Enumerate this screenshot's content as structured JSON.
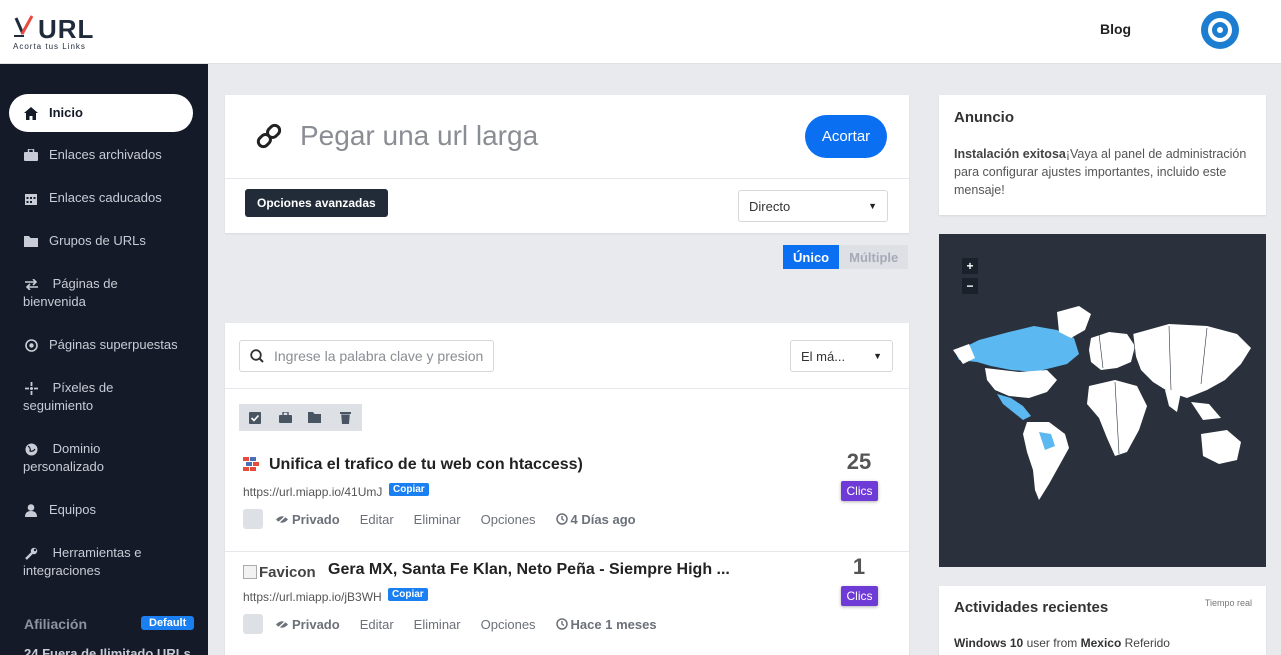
{
  "header": {
    "logo_word": "URL",
    "logo_tagline": "Acorta tus Links",
    "blog_label": "Blog"
  },
  "sidebar": {
    "items": [
      {
        "label": "Inicio",
        "icon": "home-icon"
      },
      {
        "label": "Enlaces archivados",
        "icon": "briefcase-icon"
      },
      {
        "label": "Enlaces caducados",
        "icon": "calendar-icon"
      },
      {
        "label": "Grupos de URLs",
        "icon": "folder-icon"
      },
      {
        "label": "Páginas de bienvenida",
        "icon": "arrows-icon"
      },
      {
        "label": "Páginas superpuestas",
        "icon": "target-icon"
      },
      {
        "label": "Píxeles de seguimiento",
        "icon": "crosshair-icon"
      },
      {
        "label": "Dominio personalizado",
        "icon": "globe-icon"
      },
      {
        "label": "Equipos",
        "icon": "user-icon"
      },
      {
        "label": "Herramientas e integraciones",
        "icon": "wrench-icon"
      }
    ],
    "affiliate_label": "Afiliación",
    "affiliate_badge": "Default",
    "usage_text": "24 Fuera de Ilimitado URLs"
  },
  "shorten": {
    "placeholder": "Pegar una url larga",
    "submit_label": "Acortar",
    "advanced_label": "Opciones avanzadas",
    "redirect_selected": "Directo",
    "mode_single": "Único",
    "mode_multiple": "Múltiple"
  },
  "links": {
    "search_placeholder": "Ingrese la palabra clave y presione Enter",
    "sort_selected": "El má...",
    "rows": [
      {
        "title": "Unifica el trafico de tu web con htaccess)",
        "short_url": "https://url.miapp.io/41UmJ",
        "copy_label": "Copiar",
        "privacy": "Privado",
        "edit": "Editar",
        "delete": "Eliminar",
        "options": "Opciones",
        "age": "4 Días ago",
        "clicks": "25",
        "clicks_label": "Clics"
      },
      {
        "favicon_alt": "Favicon",
        "title": "Gera MX, Santa Fe Klan, Neto Peña - Siempre High ...",
        "short_url": "https://url.miapp.io/jB3WH",
        "copy_label": "Copiar",
        "privacy": "Privado",
        "edit": "Editar",
        "delete": "Eliminar",
        "options": "Opciones",
        "age": "Hace 1 meses",
        "clicks": "1",
        "clicks_label": "Clics"
      }
    ]
  },
  "announcement": {
    "title": "Anuncio",
    "bold": "Instalación exitosa",
    "text": "¡Vaya al panel de administración para configurar ajustes importantes, incluido este mensaje!"
  },
  "map": {
    "zoom_in": "+",
    "zoom_out": "−",
    "highlight_color": "#5bb8f0",
    "land_color": "#ffffff",
    "sea_color": "#2a313c"
  },
  "activity": {
    "title": "Actividades recientes",
    "realtime": "Tiempo real",
    "os": "Windows 10",
    "text1": " user from ",
    "country": "Mexico",
    "text2": " Referido"
  },
  "colors": {
    "primary": "#0b6ff2",
    "sidebar_bg": "#141a27",
    "clicks_badge": "#6f3bd6"
  }
}
